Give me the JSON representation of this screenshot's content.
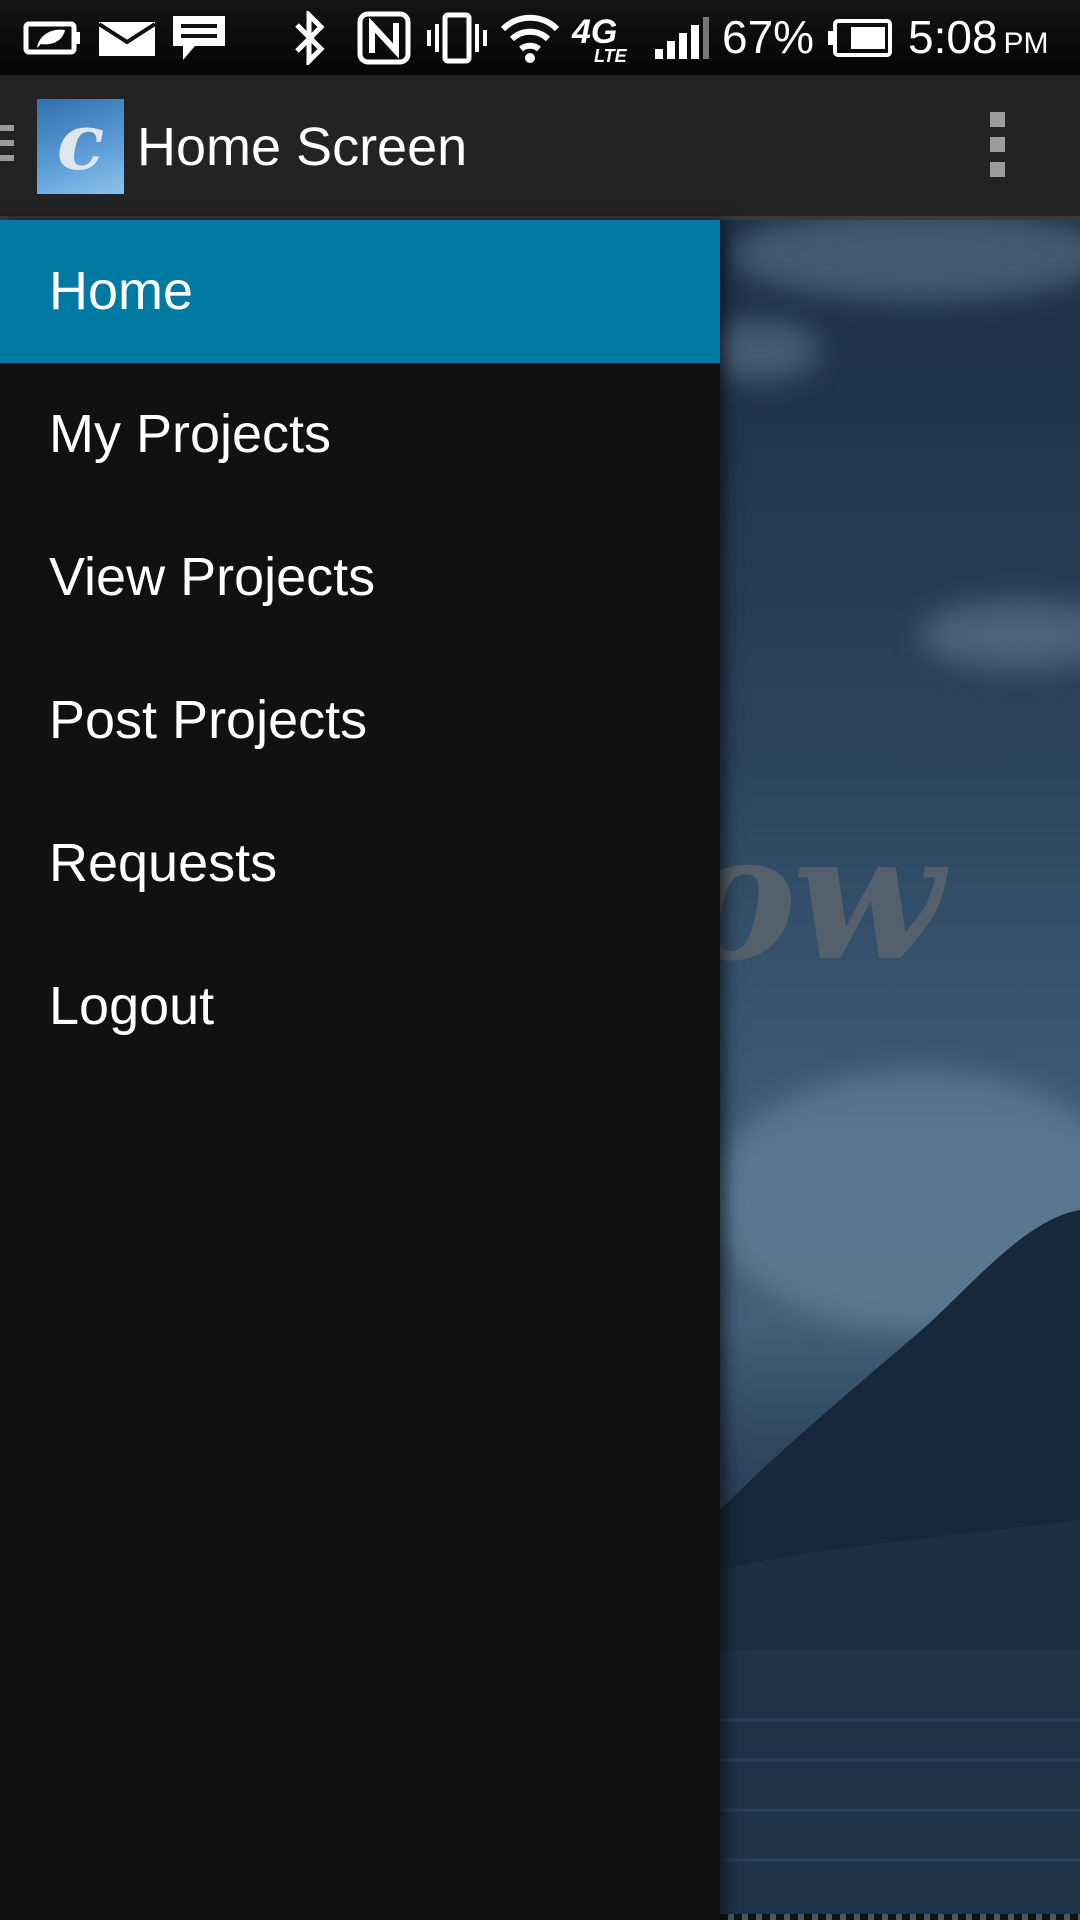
{
  "status_bar": {
    "icons": [
      "power-saver-icon",
      "mail-icon",
      "message-icon",
      "bluetooth-icon",
      "nfc-icon",
      "vibrate-icon",
      "wifi-icon",
      "lte-icon",
      "signal-icon",
      "battery-icon"
    ],
    "network_label": "4G",
    "network_sublabel": "LTE",
    "battery_percent": "67%",
    "time": "5:08",
    "time_suffix": "PM"
  },
  "action_bar": {
    "logo_letter": "c",
    "title": "Home Screen",
    "overflow_icon": "overflow-menu-icon"
  },
  "nav_drawer": {
    "items": [
      {
        "label": "Home",
        "active": true
      },
      {
        "label": "My Projects",
        "active": false
      },
      {
        "label": "View Projects",
        "active": false
      },
      {
        "label": "Post Projects",
        "active": false
      },
      {
        "label": "Requests",
        "active": false
      },
      {
        "label": "Logout",
        "active": false
      }
    ]
  },
  "background": {
    "partial_text": "ow"
  },
  "colors": {
    "active_item": "#0079a3",
    "drawer_bg": "#111111",
    "action_bar_bg": "#232323"
  }
}
